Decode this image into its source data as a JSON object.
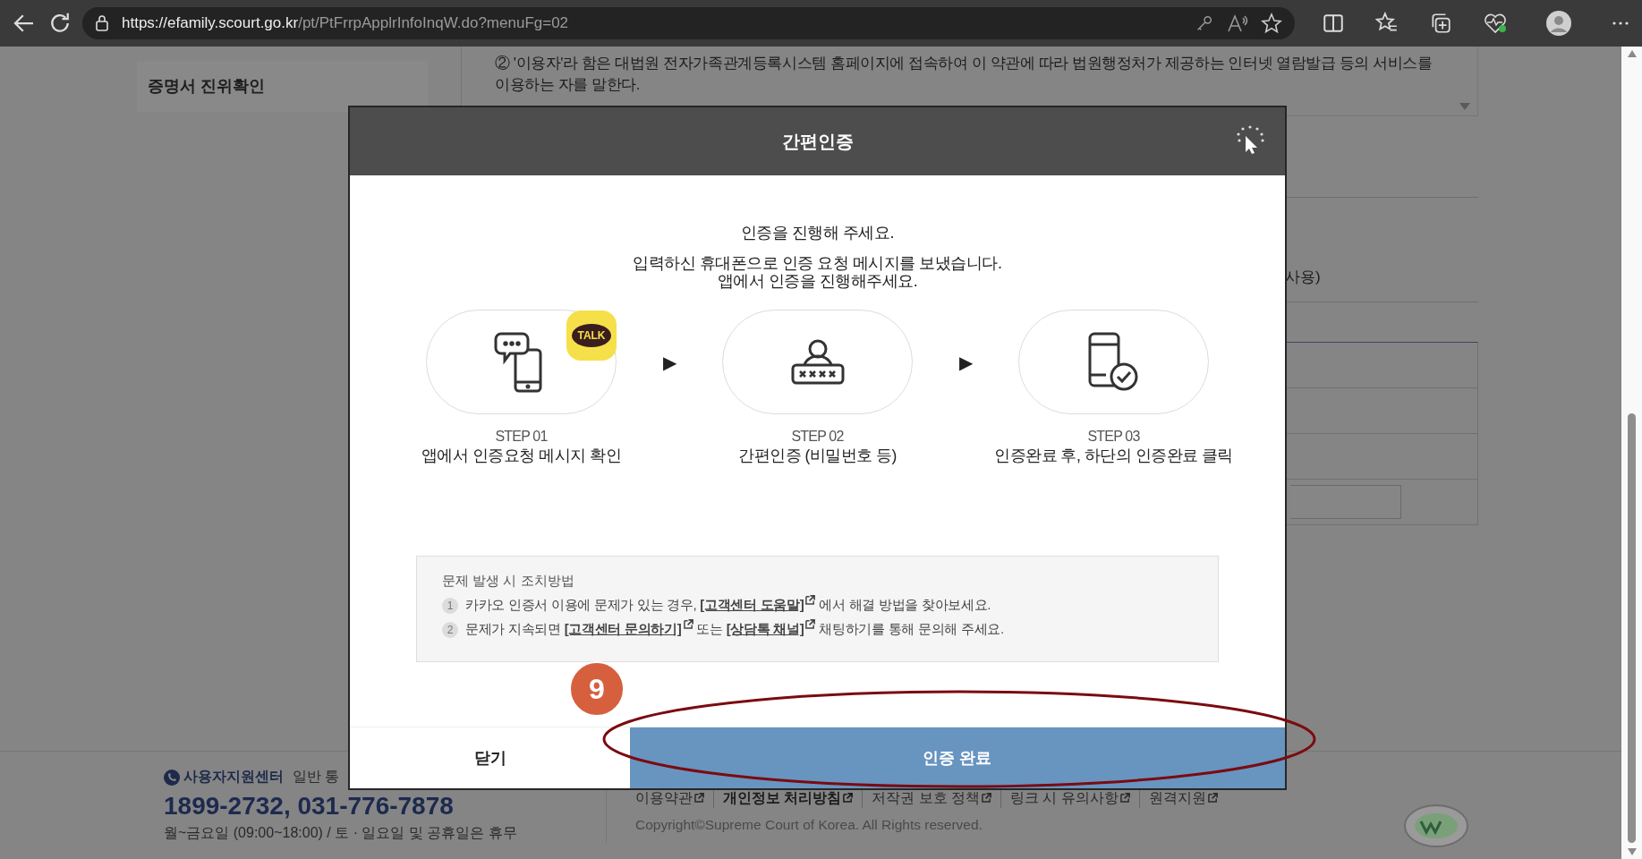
{
  "browser": {
    "url_host": "https://efamily.scourt.go.kr",
    "url_path": "/pt/PtFrrpApplrInfoInqW.do?menuFg=02"
  },
  "sidebar": {
    "items": [
      {
        "label": "증명서 진위확인"
      }
    ]
  },
  "terms": {
    "text": "② '이용자'라 함은 대법원 전자가족관계등록시스템 홈페이지에 접속하여 이 약관에 따라 법원행정처가 제공하는 인터넷 열람발급 등의 서비스를 이용하는 자를 말한다."
  },
  "background_fragment": "사용)",
  "dialog": {
    "title": "간편인증",
    "message": [
      "인증을 진행해 주세요.",
      "입력하신 휴대폰으로 인증 요청 메시지를 보냈습니다.",
      "앱에서 인증을 진행해주세요."
    ],
    "steps": [
      {
        "kind": "message",
        "badge": "TALK",
        "step": "STEP 01",
        "caption": "앱에서 인증요청 메시지 확인"
      },
      {
        "kind": "password",
        "step": "STEP 02",
        "caption": "간편인증 (비밀번호 등)"
      },
      {
        "kind": "confirm",
        "step": "STEP 03",
        "caption": "인증완료 후, 하단의 인증완료 클릭"
      }
    ],
    "arrows": [
      "▶",
      "▶"
    ],
    "help": {
      "title": "문제 발생 시 조치방법",
      "items": [
        {
          "number": "1",
          "parts": [
            {
              "kind": "text",
              "text": "카카오 인증서 이용에 문제가 있는 경우, "
            },
            {
              "kind": "link",
              "text": "[고객센터 도움말]"
            },
            {
              "kind": "text",
              "text": " 에서 해결 방법을 찾아보세요."
            }
          ]
        },
        {
          "number": "2",
          "parts": [
            {
              "kind": "text",
              "text": "문제가 지속되면 "
            },
            {
              "kind": "link",
              "text": "[고객센터 문의하기]"
            },
            {
              "kind": "text",
              "text": " 또는 "
            },
            {
              "kind": "link",
              "text": "[상담톡 채널]"
            },
            {
              "kind": "text",
              "text": " 채팅하기를 통해 문의해 주세요."
            }
          ]
        }
      ]
    },
    "buttons": [
      {
        "kind": "secondary",
        "label": "닫기"
      },
      {
        "kind": "primary",
        "label": "인증 완료"
      }
    ]
  },
  "footer": {
    "support_title": "사용자지원센터",
    "support_note": "일반 통",
    "phone": "1899-2732, 031-776-7878",
    "hours": "월~금요일 (09:00~18:00) / 토 · 일요일 및 공휴일은 휴무",
    "links": [
      {
        "label": "이용약관",
        "bold": false
      },
      {
        "label": "개인정보 처리방침",
        "bold": true
      },
      {
        "label": "저작권 보호 정책",
        "bold": false
      },
      {
        "label": "링크 시 유의사항",
        "bold": false
      },
      {
        "label": "원격지원",
        "bold": false
      }
    ],
    "copyright": "Copyright©Supreme Court of Korea. All Rights reserved."
  },
  "annotation": {
    "label": "9"
  }
}
